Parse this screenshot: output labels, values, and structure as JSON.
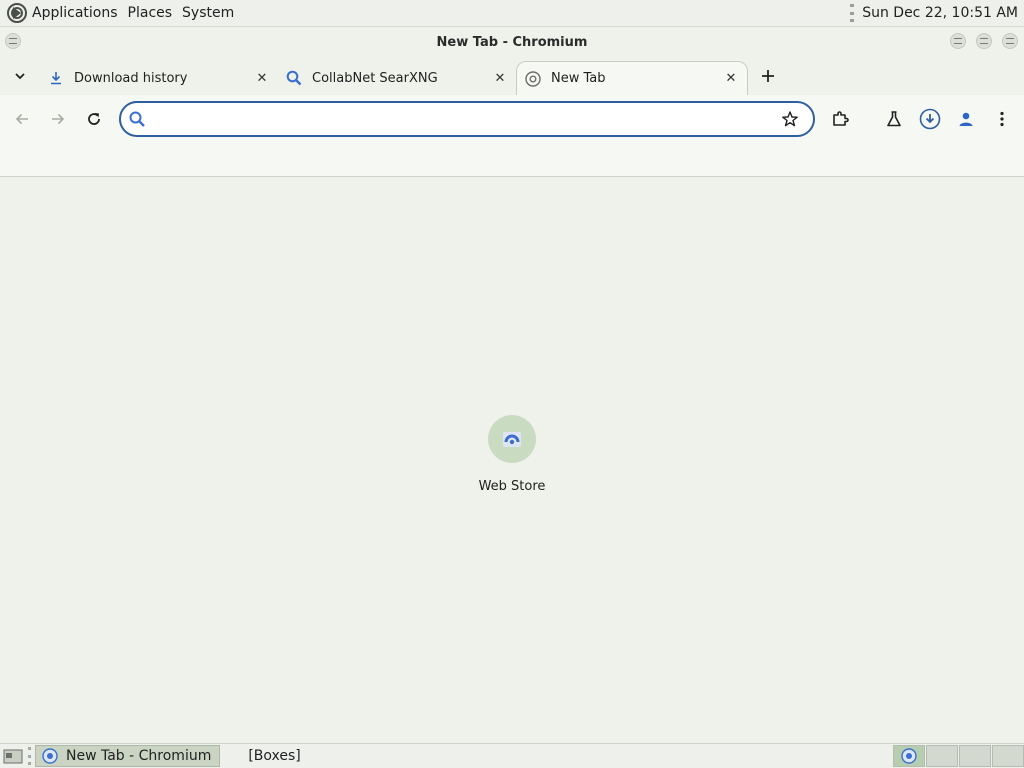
{
  "top_panel": {
    "menus": [
      "Applications",
      "Places",
      "System"
    ],
    "clock": "Sun Dec 22, 10:51 AM"
  },
  "window": {
    "title": "New Tab - Chromium"
  },
  "tabs": [
    {
      "label": "Download history",
      "icon": "download-icon",
      "active": false
    },
    {
      "label": "CollabNet SearXNG",
      "icon": "search-icon",
      "active": false
    },
    {
      "label": "New Tab",
      "icon": "chromium-icon",
      "active": true
    }
  ],
  "omnibox": {
    "value": "",
    "placeholder": ""
  },
  "shortcuts": [
    {
      "label": "Web Store",
      "icon": "web-store-icon"
    }
  ],
  "taskbar": {
    "tasks": [
      {
        "label": "New Tab - Chromium",
        "icon": "chromium-icon",
        "active": true
      },
      {
        "label": "[Boxes]",
        "active": false
      }
    ]
  },
  "colors": {
    "accent": "#2e5f9e",
    "page_background": "#eef2ea",
    "shortcut_tile": "#c9dcc1"
  }
}
